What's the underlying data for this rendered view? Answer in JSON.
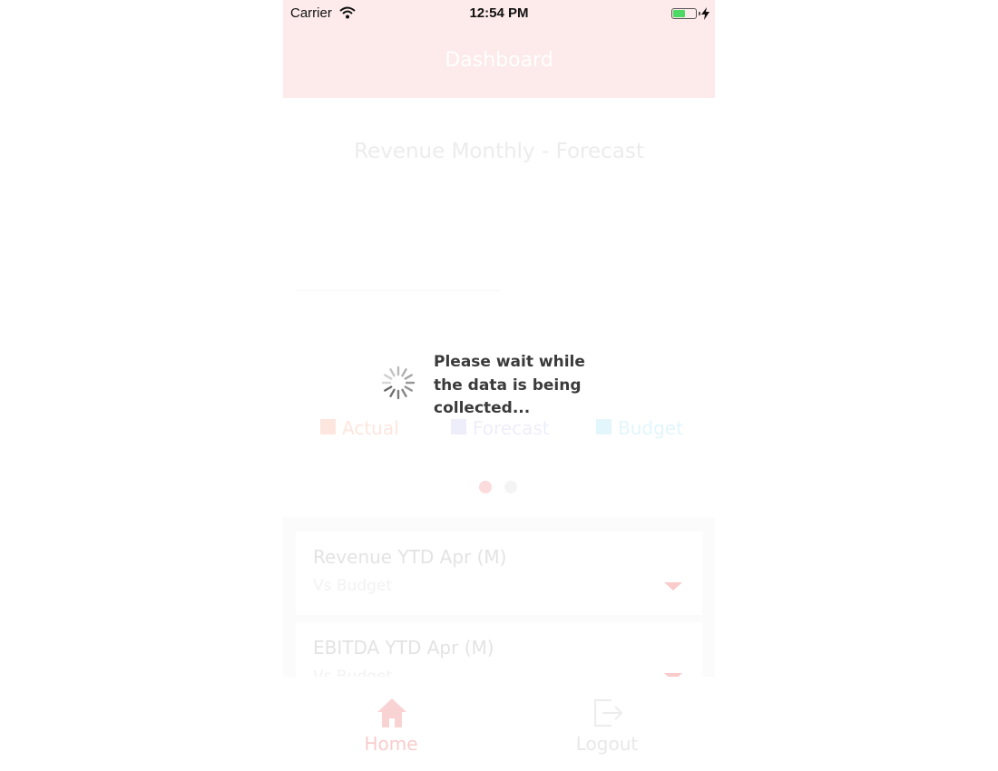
{
  "status_bar": {
    "carrier": "Carrier",
    "time": "12:54 PM",
    "battery_level": 0.55
  },
  "nav": {
    "title": "Dashboard"
  },
  "chart": {
    "title": "Revenue Monthly - Forecast",
    "legend": [
      {
        "label": "Actual",
        "color": "#fde6de"
      },
      {
        "label": "Forecast",
        "color": "#eeeefb"
      },
      {
        "label": "Budget",
        "color": "#e2f6fc"
      }
    ],
    "page_dots": {
      "count": 2,
      "active_index": 0
    }
  },
  "cards": [
    {
      "title": "Revenue YTD Apr (M)",
      "subtitle": "Vs Budget"
    },
    {
      "title": "EBITDA YTD Apr (M)",
      "subtitle": "Vs Budget"
    }
  ],
  "tab_bar": {
    "home_label": "Home",
    "logout_label": "Logout",
    "home_icon": "home-icon",
    "logout_icon": "logout-icon"
  },
  "loading": {
    "message": "Please wait while the data is being collected..."
  },
  "colors": {
    "accent": "#f8c9c9",
    "header_bg": "#fdeaea",
    "active_dot": "#fbdbdb",
    "inactive_dot": "#f4f4f4"
  }
}
